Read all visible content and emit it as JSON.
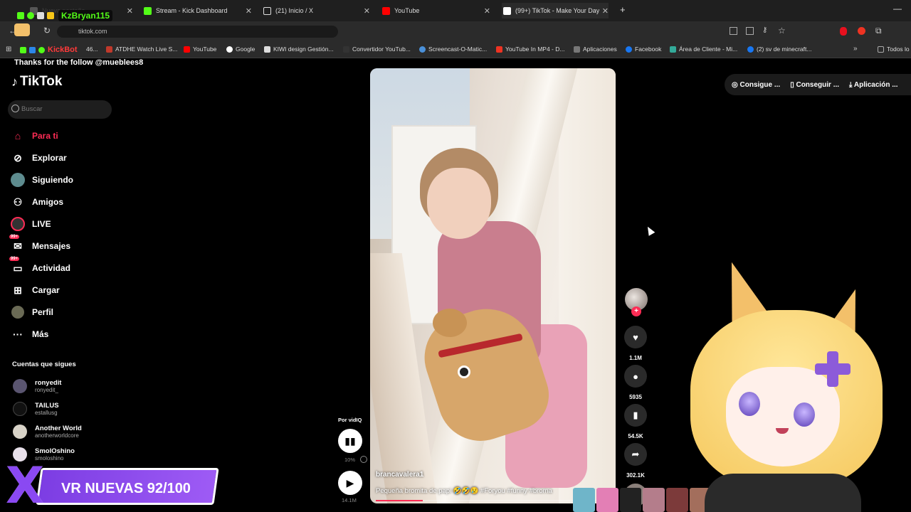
{
  "browser": {
    "tabs": [
      {
        "title": "Nueva pestaña",
        "color": "#555555"
      },
      {
        "title": "Stream - Kick Dashboard",
        "color": "#53fc18"
      },
      {
        "title": "(21) Inicio / X",
        "color": "#ffffff"
      },
      {
        "title": "YouTube",
        "color": "#ff0000"
      },
      {
        "title": "(99+) TikTok - Make Your Day",
        "color": "#ffffff"
      }
    ],
    "url": "tiktok.com",
    "bookmarks": [
      "KickBot",
      "46...",
      "ATDHE Watch Live S...",
      "YouTube",
      "Google",
      "KIWI design Gestión...",
      "Convertidor YouTub...",
      "Screencast-O-Matic...",
      "YouTube In MP4 - D...",
      "Aplicaciones",
      "Facebook",
      "Área de Cliente - Mi...",
      "(2) sv de minecraft...",
      "Todos lo"
    ]
  },
  "overlay": {
    "username": "KzBryan115",
    "thanks": "Thanks for the follow @mueblees8",
    "vr_text": "VR NUEVAS 92/100"
  },
  "tiktok": {
    "logo": "TikTok",
    "search_placeholder": "Buscar",
    "nav": [
      {
        "label": "Para ti",
        "icon": "home-icon",
        "active": true
      },
      {
        "label": "Explorar",
        "icon": "compass-icon"
      },
      {
        "label": "Siguiendo",
        "icon": "following-icon"
      },
      {
        "label": "Amigos",
        "icon": "friends-icon"
      },
      {
        "label": "LIVE",
        "icon": "live-icon"
      },
      {
        "label": "Mensajes",
        "icon": "messages-icon",
        "badge": "99+"
      },
      {
        "label": "Actividad",
        "icon": "activity-icon",
        "badge": "99+"
      },
      {
        "label": "Cargar",
        "icon": "upload-icon"
      },
      {
        "label": "Perfil",
        "icon": "profile-icon"
      },
      {
        "label": "Más",
        "icon": "more-icon"
      }
    ],
    "following_title": "Cuentas que sigues",
    "following": [
      {
        "name": "ronyedit",
        "handle": "ronyedit_"
      },
      {
        "name": "TAILUS",
        "handle": "estallusg"
      },
      {
        "name": "Another World",
        "handle": "anotherworldcore"
      },
      {
        "name": "SmolOshino",
        "handle": "smoloshino"
      }
    ],
    "top_buttons": [
      "Consigue ...",
      "Conseguir ...",
      "Aplicación ..."
    ],
    "video": {
      "username": "brancavalera1",
      "description": "Pequeña bromita de papi 🤣🤣😢 #Foryou #funny #broma",
      "progress": 0.2
    },
    "by_label": "Por vidIQ",
    "vidiq_percent": "10%",
    "views": "14.1M",
    "actions": [
      {
        "icon": "heart-icon",
        "glyph": "♥",
        "count": "1.1M"
      },
      {
        "icon": "comment-icon",
        "glyph": "●",
        "count": "5935"
      },
      {
        "icon": "bookmark-icon",
        "glyph": "▮",
        "count": "54.5K"
      },
      {
        "icon": "share-icon",
        "glyph": "➦",
        "count": "302.1K"
      }
    ]
  },
  "colors": {
    "accent": "#fe2c55",
    "kick": "#53fc18",
    "overlay_purple": "#8a49f2"
  }
}
